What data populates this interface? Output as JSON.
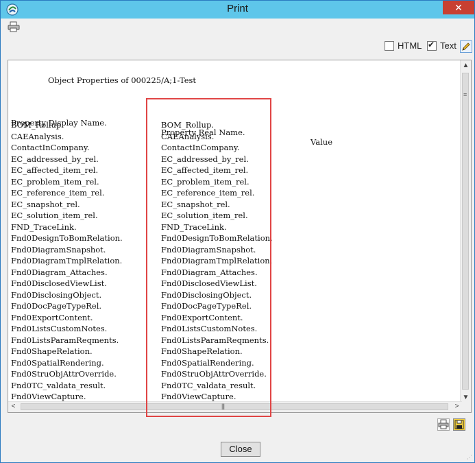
{
  "window": {
    "title": "Print",
    "close_glyph": "✕"
  },
  "toolbar": {
    "print_icon": "printer-icon"
  },
  "options": {
    "html_label": "HTML",
    "html_checked": false,
    "text_label": "Text",
    "text_checked": true,
    "edit_icon": "edit-icon"
  },
  "document": {
    "title": "Object Properties of 000225/A;1-Test",
    "headers": [
      "Property Display Name.",
      "Property Real Name.",
      "Value"
    ],
    "rows": [
      [
        "BOM_Rollup.",
        "BOM_Rollup."
      ],
      [
        "CAEAnalysis.",
        "CAEAnalysis."
      ],
      [
        "ContactInCompany.",
        "ContactInCompany."
      ],
      [
        "EC_addressed_by_rel.",
        "EC_addressed_by_rel."
      ],
      [
        "EC_affected_item_rel.",
        "EC_affected_item_rel."
      ],
      [
        "EC_problem_item_rel.",
        "EC_problem_item_rel."
      ],
      [
        "EC_reference_item_rel.",
        "EC_reference_item_rel."
      ],
      [
        "EC_snapshot_rel.",
        "EC_snapshot_rel."
      ],
      [
        "EC_solution_item_rel.",
        "EC_solution_item_rel."
      ],
      [
        "FND_TraceLink.",
        "FND_TraceLink."
      ],
      [
        "Fnd0DesignToBomRelation.",
        "Fnd0DesignToBomRelation."
      ],
      [
        "Fnd0DiagramSnapshot.",
        "Fnd0DiagramSnapshot."
      ],
      [
        "Fnd0DiagramTmplRelation.",
        "Fnd0DiagramTmplRelation."
      ],
      [
        "Fnd0Diagram_Attaches.",
        "Fnd0Diagram_Attaches."
      ],
      [
        "Fnd0DisclosedViewList.",
        "Fnd0DisclosedViewList."
      ],
      [
        "Fnd0DisclosingObject.",
        "Fnd0DisclosingObject."
      ],
      [
        "Fnd0DocPageTypeRel.",
        "Fnd0DocPageTypeRel."
      ],
      [
        "Fnd0ExportContent.",
        "Fnd0ExportContent."
      ],
      [
        "Fnd0ListsCustomNotes.",
        "Fnd0ListsCustomNotes."
      ],
      [
        "Fnd0ListsParamReqments.",
        "Fnd0ListsParamReqments."
      ],
      [
        "Fnd0ShapeRelation.",
        "Fnd0ShapeRelation."
      ],
      [
        "Fnd0SpatialRendering.",
        "Fnd0SpatialRendering."
      ],
      [
        "Fnd0StruObjAttrOverride.",
        "Fnd0StruObjAttrOverride."
      ],
      [
        "Fnd0TC_valdata_result.",
        "Fnd0TC_valdata_result."
      ],
      [
        "Fnd0ViewCapture.",
        "Fnd0ViewCapture."
      ]
    ]
  },
  "scrollbars": {
    "up": "▲",
    "down": "▼",
    "left": "<",
    "right": ">",
    "hgrip": "|||",
    "vgrip": "≡"
  },
  "footer": {
    "print_icon": "printer-icon",
    "save_icon": "save-icon",
    "close_label": "Close"
  },
  "colors": {
    "titlebar": "#5ec6ea",
    "close": "#c84031",
    "highlight_box": "#e04545"
  }
}
